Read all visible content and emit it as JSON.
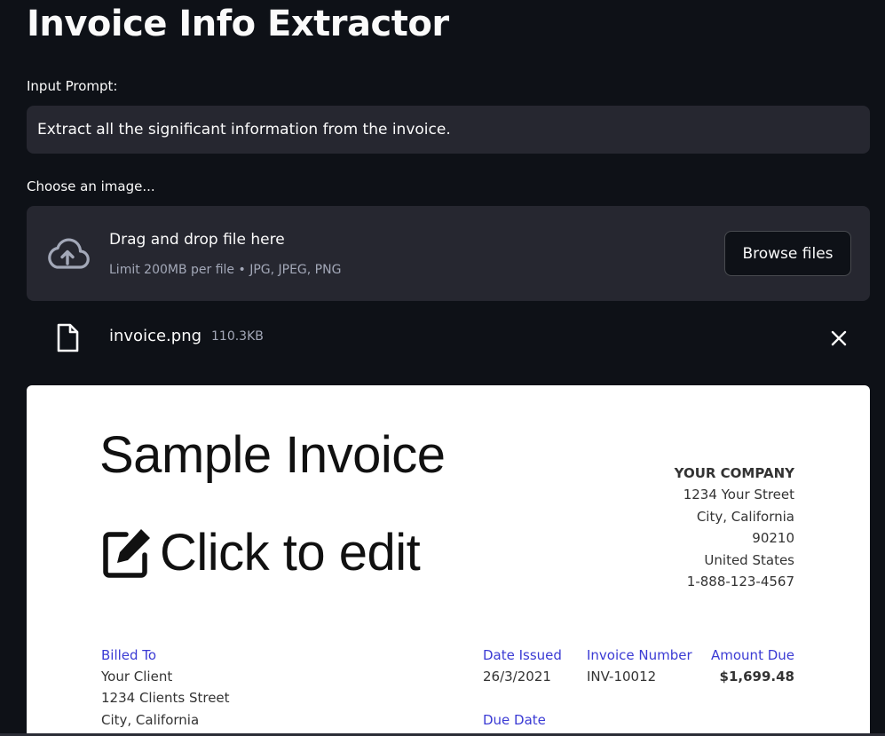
{
  "app": {
    "title": "Invoice Info Extractor"
  },
  "prompt": {
    "label": "Input Prompt:",
    "value": "Extract all the significant information from the invoice."
  },
  "uploader": {
    "label": "Choose an image...",
    "dropzone_title": "Drag and drop file here",
    "limit_text": "Limit 200MB per file • JPG, JPEG, PNG",
    "browse_label": "Browse files",
    "icon": "cloud-upload-icon"
  },
  "uploaded_file": {
    "name": "invoice.png",
    "size": "110.3KB",
    "icon": "file-icon",
    "remove_icon": "close-icon"
  },
  "invoice": {
    "title": "Sample Invoice",
    "edit_text": "Click to edit",
    "company": {
      "name": "YOUR COMPANY",
      "street": "1234 Your Street",
      "city": "City, California",
      "zip": "90210",
      "country": "United States",
      "phone": "1-888-123-4567"
    },
    "billed_to": {
      "label": "Billed To",
      "name": "Your Client",
      "street": "1234 Clients Street",
      "city": "City, California"
    },
    "date_issued": {
      "label": "Date Issued",
      "value": "26/3/2021"
    },
    "invoice_number": {
      "label": "Invoice Number",
      "value": "INV-10012"
    },
    "amount_due": {
      "label": "Amount Due",
      "value": "$1,699.48"
    },
    "due_date": {
      "label": "Due Date"
    },
    "label_color": "#3b3bd4"
  },
  "colors": {
    "background": "#0e1117",
    "surface": "#262730",
    "text": "#fafafa",
    "muted_text": "#a3a8b8"
  }
}
